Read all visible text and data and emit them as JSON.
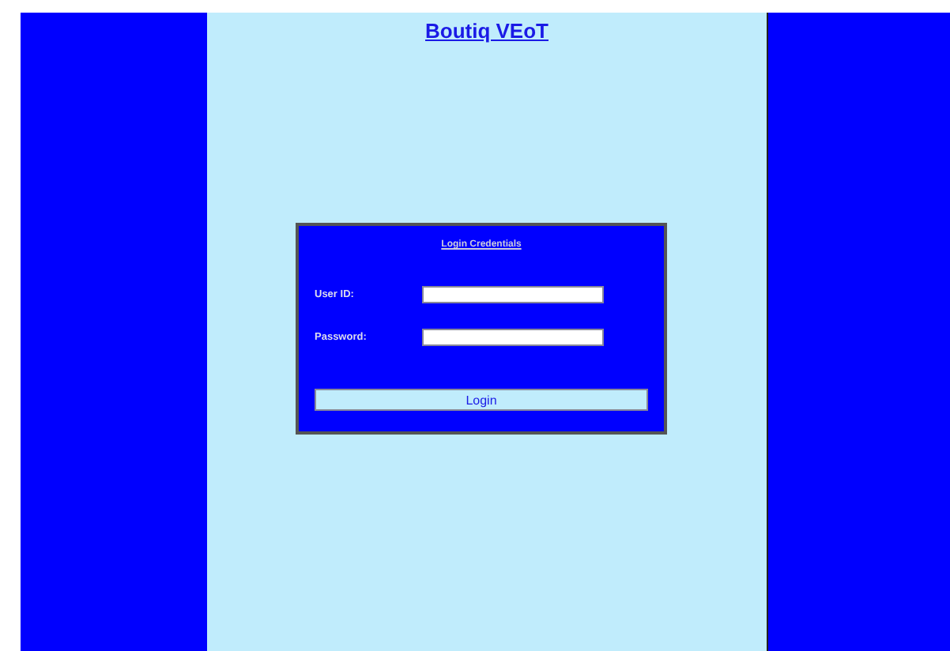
{
  "site_title": "Boutiq VEoT",
  "login_panel": {
    "heading": "Login Credentials",
    "fields": [
      {
        "label": "User ID:"
      },
      {
        "label": "Password:"
      }
    ],
    "button": "Login"
  }
}
